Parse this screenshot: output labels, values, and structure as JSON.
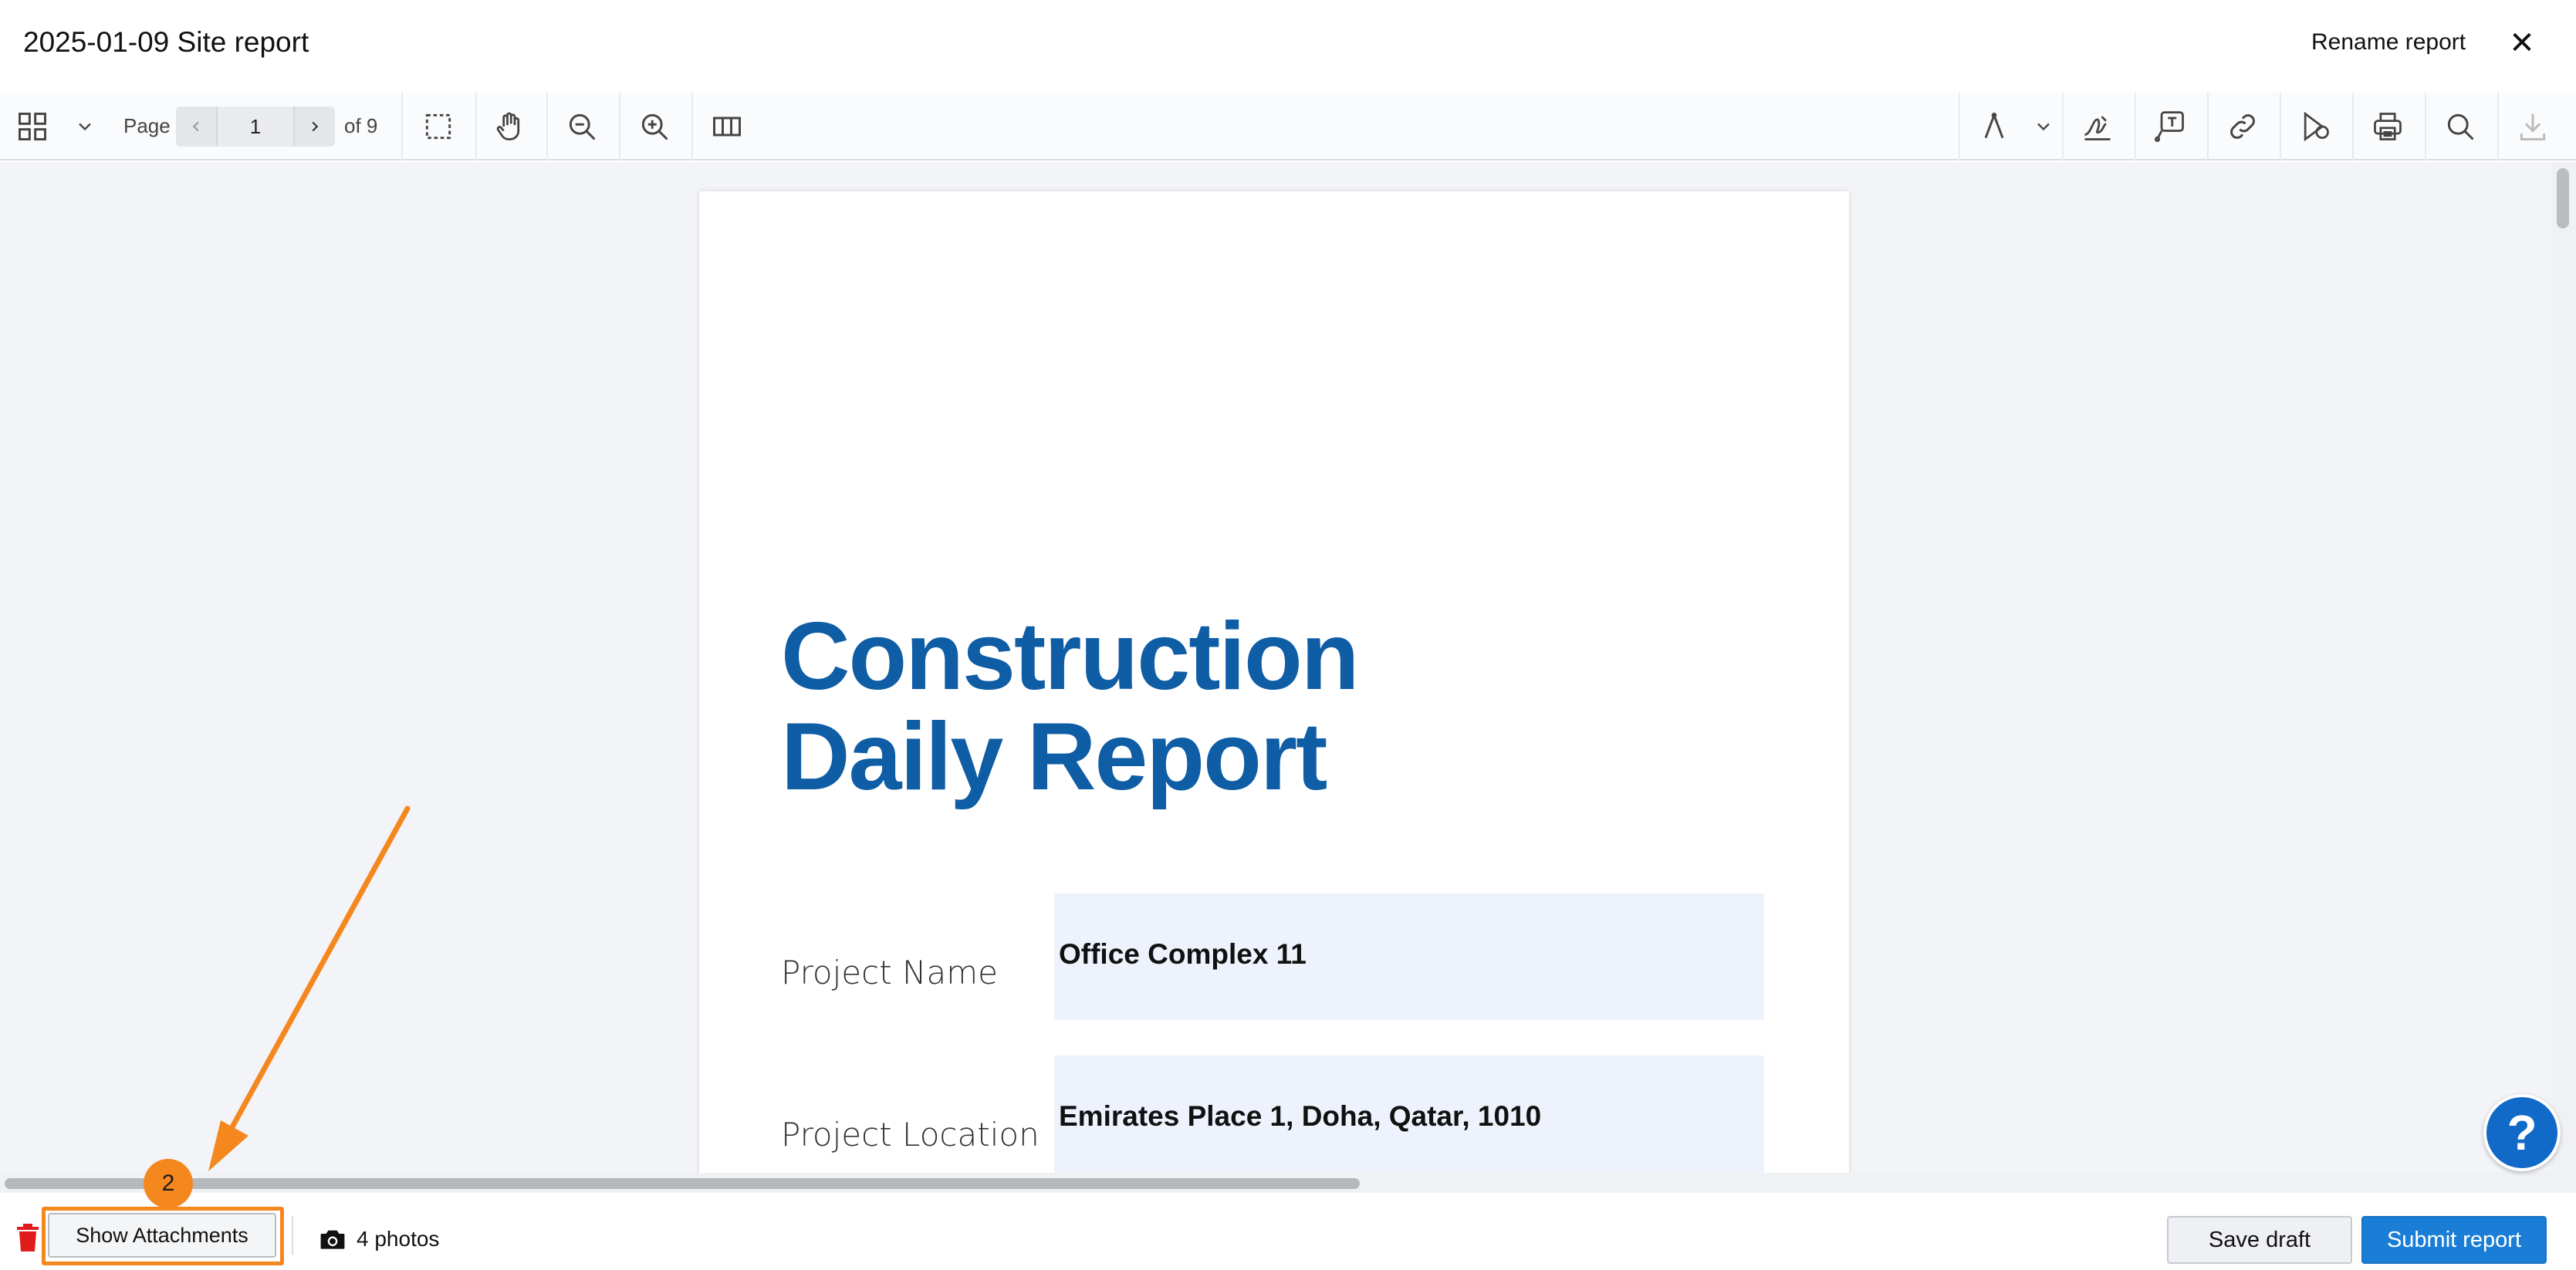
{
  "window": {
    "title": "2025-01-09 Site report",
    "rename_label": "Rename report",
    "close_glyph": "✕"
  },
  "toolbar": {
    "page_label": "Page",
    "current_page": "1",
    "total_pages": "of 9",
    "left_icons": [
      "thumbnails-icon",
      "marquee-select-icon",
      "pan-hand-icon",
      "zoom-out-icon",
      "zoom-in-icon",
      "two-page-view-icon"
    ],
    "right_icons": [
      "draw-tool-icon",
      "signature-icon",
      "text-comment-icon",
      "link-icon",
      "shapes-icon",
      "print-icon",
      "search-icon",
      "download-icon"
    ]
  },
  "document": {
    "title_line1": "Construction",
    "title_line2": "Daily Report",
    "fields": [
      {
        "label": "Project Name",
        "value": "Office Complex 11"
      },
      {
        "label": "Project Location",
        "value": "Emirates Place 1, Doha, Qatar, 1010"
      }
    ]
  },
  "help_button": {
    "glyph": "?"
  },
  "footer": {
    "attachments_label": "Show Attachments",
    "photos_count": "4 photos",
    "save_draft_label": "Save draft",
    "submit_label": "Submit report"
  },
  "annotation": {
    "step_number": "2",
    "color": "#f5871f"
  },
  "colors": {
    "accent": "#1b7ed6",
    "doc_title": "#0f5da5",
    "field_bg": "#edf2fd",
    "delete": "#e01b1b"
  }
}
